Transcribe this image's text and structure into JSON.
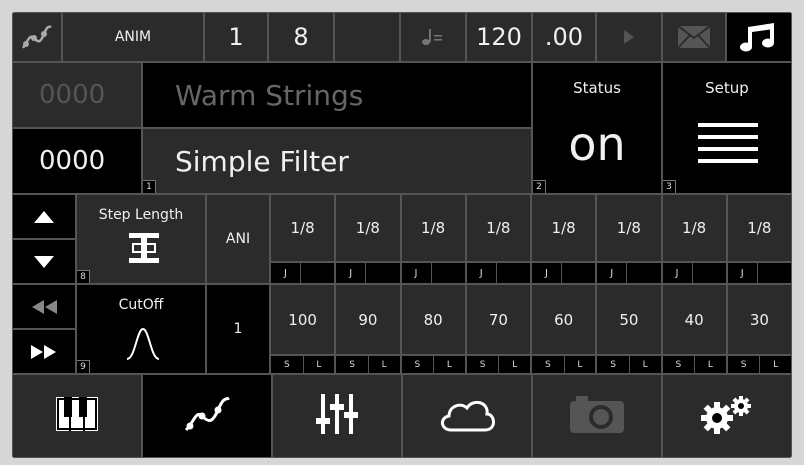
{
  "top_bar": {
    "mode_label": "ANIM",
    "value_1": "1",
    "value_2": "8",
    "tempo_value": "120",
    "tempo_fraction": ".00",
    "icons": [
      "automation-icon",
      "quarter-note-icon",
      "play-icon",
      "mail-icon",
      "music-notes-icon"
    ]
  },
  "presets": {
    "top_number": "0000",
    "top_name": "Warm Strings",
    "bottom_number": "0000",
    "bottom_name": "Simple Filter",
    "slot_number": "1"
  },
  "status": {
    "title": "Status",
    "value": "on",
    "slot_number": "2"
  },
  "setup": {
    "title": "Setup",
    "slot_number": "3"
  },
  "step_row": {
    "label": "Step Length",
    "slot_number": "8",
    "mode": "ANI",
    "steps": [
      "1/8",
      "1/8",
      "1/8",
      "1/8",
      "1/8",
      "1/8",
      "1/8",
      "1/8"
    ],
    "flag": "J"
  },
  "cutoff_row": {
    "label": "CutOff",
    "slot_number": "9",
    "mode": "1",
    "values": [
      "100",
      "90",
      "80",
      "70",
      "60",
      "50",
      "40",
      "30"
    ],
    "flag_s": "S",
    "flag_l": "L"
  },
  "bottom_nav": {
    "items": [
      "piano-keys-icon",
      "automation-curve-icon",
      "mixer-sliders-icon",
      "cloud-icon",
      "camera-icon",
      "gears-icon"
    ],
    "active_index": 1
  }
}
